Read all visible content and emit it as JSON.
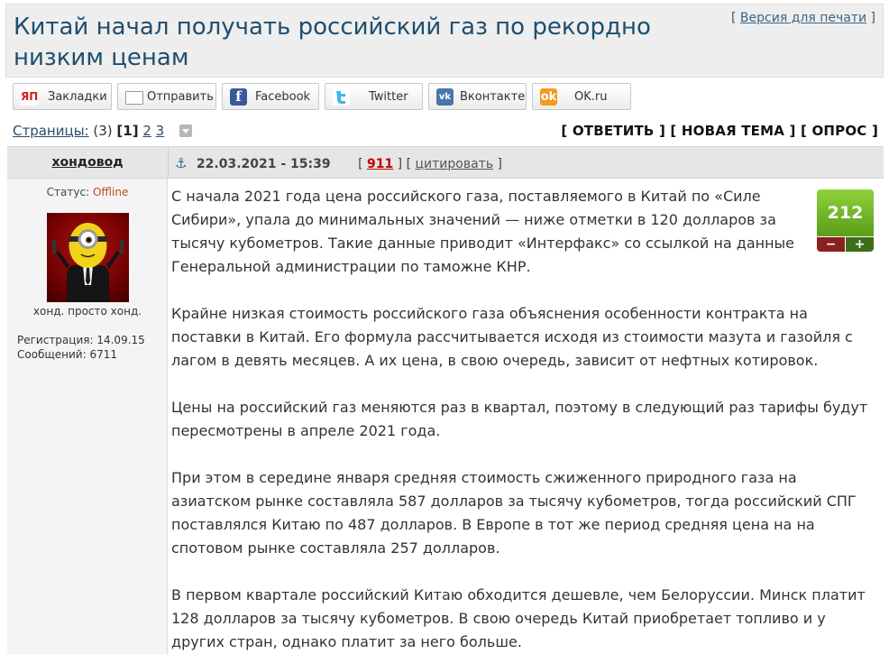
{
  "topic": {
    "title": "Китай начал получать российский газ по рекордно низким ценам",
    "print_link": "Версия для печати"
  },
  "share": [
    {
      "label": "Закладки",
      "icon": "yandex-bookmarks-icon",
      "glyph": "ЯП"
    },
    {
      "label": "Отправить",
      "icon": "mail-icon",
      "glyph": ""
    },
    {
      "label": "Facebook",
      "icon": "facebook-icon",
      "glyph": "f"
    },
    {
      "label": "Twitter",
      "icon": "twitter-icon",
      "glyph": "t"
    },
    {
      "label": "Вконтакте",
      "icon": "vkontakte-icon",
      "glyph": "vk"
    },
    {
      "label": "OK.ru",
      "icon": "odnoklassniki-icon",
      "glyph": "ok"
    }
  ],
  "pagination": {
    "label": "Страницы:",
    "count": "(3)",
    "current": "[1]",
    "pages": [
      "2",
      "3"
    ]
  },
  "actions": {
    "reply": "ОТВЕТИТЬ",
    "new_topic": "НОВАЯ ТЕМА",
    "poll": "ОПРОС"
  },
  "post": {
    "author": "хондовод",
    "datetime": "22.03.2021 - 15:39",
    "number": "911",
    "quote_label": "цитировать",
    "status_label": "Статус:",
    "status_value": "Offline",
    "user_title": "хонд. просто хонд.",
    "registration_label": "Регистрация:",
    "registration_date": "14.09.15",
    "posts_label": "Сообщений:",
    "posts_count": "6711",
    "rating": "212",
    "rating_minus": "−",
    "rating_plus": "+",
    "paragraphs": [
      "С начала 2021 года цена российского газа, поставляемого в Китай по «Силе Сибири», упала до минимальных значений — ниже отметки в 120 долларов за тысячу кубометров. Такие данные приводит «Интерфакс» со ссылкой на данные Генеральной администрации по таможне КНР.",
      "Крайне низкая стоимость российского газа объяснения особенности контракта на поставки в Китай. Его формула рассчитывается исходя из стоимости мазута и газойля с лагом в девять месяцев. А их цена, в свою очередь, зависит от нефтных котировок.",
      "Цены на российский газ меняются раз в квартал, поэтому в следующий раз тарифы будут пересмотрены в апреле 2021 года.",
      "При этом в середине января средняя стоимость сжиженного природного газа на азиатском рынке составляла 587 долларов за тысячу кубометров, тогда российский СПГ поставлялся Китаю по 487 долларов. В Европе в тот же период средняя цена на на спотовом рынке составляла 257 долларов.",
      "В первом квартале российский Китаю обходится дешевле, чем Белоруссии. Минск платит 128 долларов за тысячу кубометров. В свою очередь Китай приобретает топливо и у других стран, однако платит за него больше."
    ]
  },
  "colors": {
    "title": "#1f4e6e",
    "offline": "#c04a1a",
    "post_number": "#c00000",
    "rating_green": "#5b9e1a",
    "rating_minus_bg": "#8a2020",
    "rating_plus_bg": "#3d6f1a"
  }
}
